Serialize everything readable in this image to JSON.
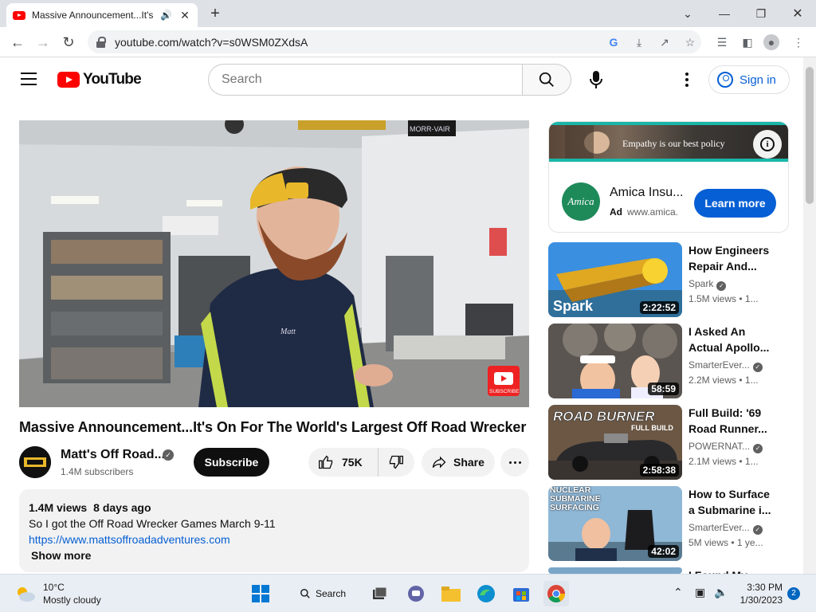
{
  "browser": {
    "tab_title": "Massive Announcement...It's On For The World's Largest Off Road Wrecker",
    "url": "youtube.com/watch?v=s0WSM0ZXdsA"
  },
  "header": {
    "logo_text": "YouTube",
    "search_placeholder": "Search",
    "signin_label": "Sign in"
  },
  "video": {
    "title": "Massive Announcement...It's On For The World's Largest Off Road Wrecker",
    "channel_name": "Matt's Off Road...",
    "subscribers": "1.4M subscribers",
    "subscribe_label": "Subscribe",
    "likes": "75K",
    "share_label": "Share",
    "overlay_sign": "MORR-VAIR",
    "overlay_subscribe": "SUBSCRIBE",
    "shirt_name": "Matt"
  },
  "description": {
    "views": "1.4M views",
    "age": "8 days ago",
    "text": "So I got the Off Road Wrecker Games March 9-11",
    "link": "https://www.mattsoffroadadventures.com",
    "show_more": "Show more"
  },
  "ad": {
    "tagline": "Empathy is our best policy",
    "logo_text": "Amica",
    "name": "Amica Insu...",
    "badge": "Ad",
    "domain": "www.amica.",
    "cta": "Learn more"
  },
  "recommendations": [
    {
      "title": "How Engineers Repair And...",
      "channel": "Spark",
      "verified": true,
      "views": "1.5M views",
      "age": "1...",
      "duration": "2:22:52",
      "thumb_text": "Spark"
    },
    {
      "title": "I Asked An Actual Apollo...",
      "channel": "SmarterEver...",
      "verified": true,
      "views": "2.2M views",
      "age": "1...",
      "duration": "58:59",
      "thumb_text": ""
    },
    {
      "title": "Full Build: '69 Road Runner...",
      "channel": "POWERNAT...",
      "verified": true,
      "views": "2.1M views",
      "age": "1...",
      "duration": "2:58:38",
      "thumb_text": "ROAD BURNER",
      "thumb_sub": "FULL BUILD"
    },
    {
      "title": "How to Surface a Submarine i...",
      "channel": "SmarterEver...",
      "verified": true,
      "views": "5M views",
      "age": "1 ye...",
      "duration": "42:02",
      "thumb_text": "NUCLEAR SUBMARINE SURFACING"
    },
    {
      "title": "I Found My Off...",
      "channel": "",
      "verified": false,
      "views": "",
      "age": "",
      "duration": "",
      "thumb_text": ""
    }
  ],
  "taskbar": {
    "temperature": "10°C",
    "weather": "Mostly cloudy",
    "search_label": "Search",
    "time": "3:30 PM",
    "date": "1/30/2023",
    "notifications": "2"
  },
  "colors": {
    "yt_red": "#ff0000",
    "link_blue": "#065fd4",
    "ad_teal": "#19b6a8"
  }
}
